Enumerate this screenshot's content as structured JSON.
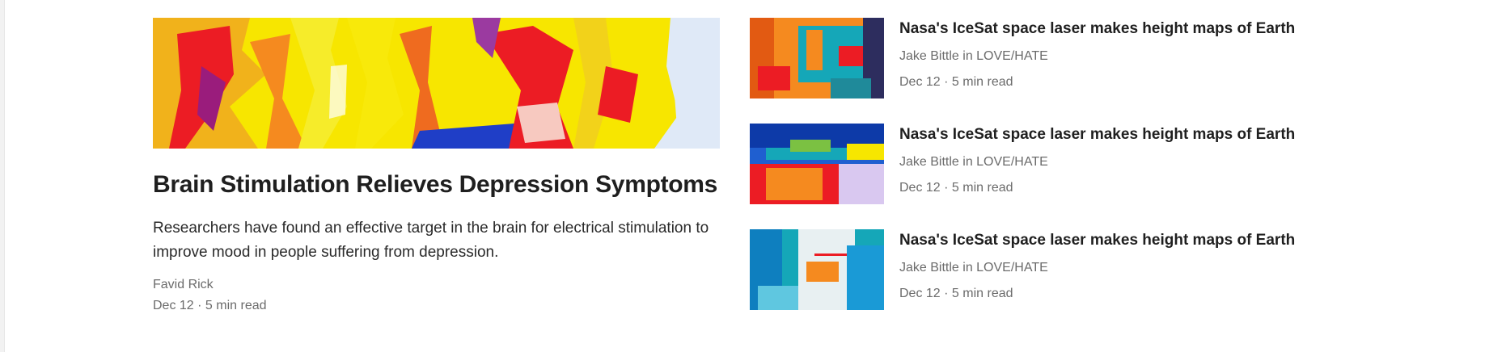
{
  "featured": {
    "image_name": "abstract-paint-yellow-red",
    "title": "Brain Stimulation Relieves Depression Symptoms",
    "excerpt": "Researchers have found an effective target in the brain for electrical stimulation to improve mood in people suffering from depression.",
    "author": "Favid Rick",
    "meta": "Dec 12 · 5 min read"
  },
  "side_articles": [
    {
      "image_name": "abstract-paint-orange-teal",
      "title": "Nasa's IceSat space laser makes height maps of Earth",
      "author": "Jake Bittle in LOVE/HATE",
      "meta": "Dec 12 · 5 min read"
    },
    {
      "image_name": "abstract-paint-blue-red",
      "title": "Nasa's IceSat space laser makes height maps of Earth",
      "author": "Jake Bittle in LOVE/HATE",
      "meta": "Dec 12 · 5 min read"
    },
    {
      "image_name": "abstract-paint-cyan-white",
      "title": "Nasa's IceSat space laser makes height maps of Earth",
      "author": "Jake Bittle in LOVE/HATE",
      "meta": "Dec 12 · 5 min read"
    }
  ],
  "colors": {
    "text_primary": "#1f1f1f",
    "text_muted": "#6b6b6b",
    "yellow": "#f7e600",
    "red": "#ec1c24",
    "orange": "#f58a1f",
    "blue": "#1f5fd0",
    "teal": "#15a7b8"
  }
}
